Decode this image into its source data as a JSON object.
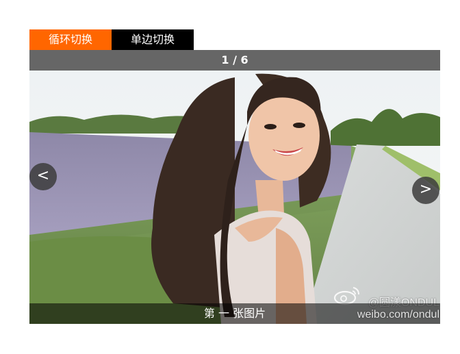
{
  "tabs": [
    {
      "label": "循环切换",
      "active": true
    },
    {
      "label": "单边切换",
      "active": false
    }
  ],
  "counter": "1 / 6",
  "nav": {
    "prev_label": "<",
    "next_label": ">"
  },
  "caption": "第 一 张图片",
  "watermark": {
    "handle": "@圆漾ONDUL",
    "url": "weibo.com/ondul",
    "logo_icon": "weibo-icon"
  },
  "colors": {
    "active_tab": "#ff6600",
    "inactive_tab": "#000000",
    "counter_bar": "#666666"
  }
}
